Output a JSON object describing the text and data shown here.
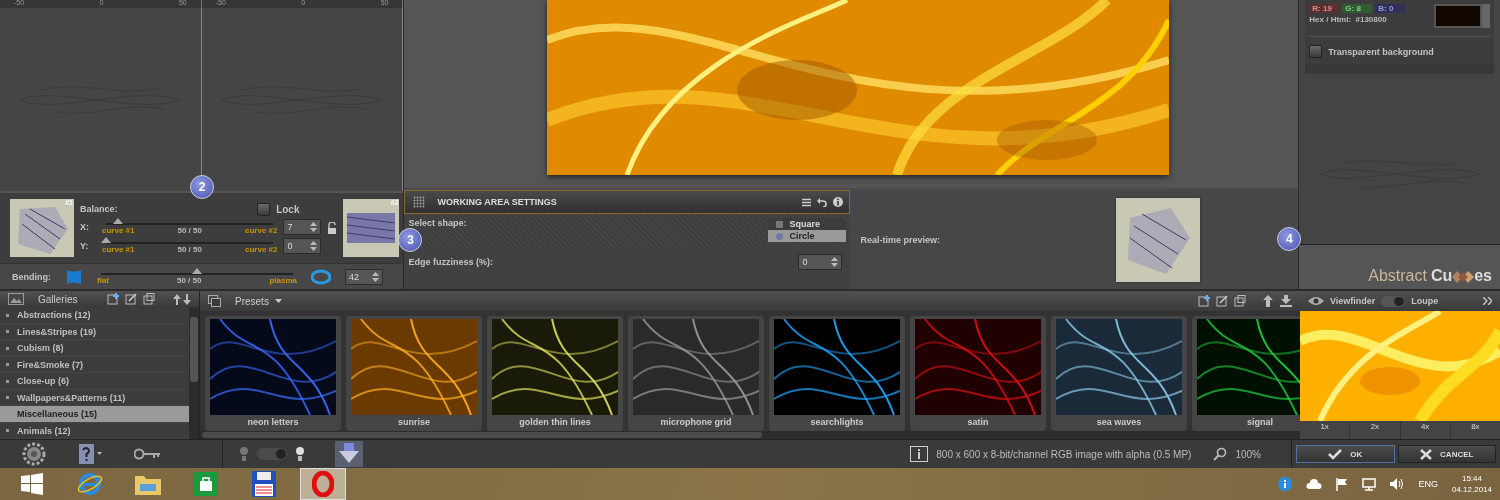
{
  "rulers": [
    {
      "ticks": [
        "-50",
        "0",
        "50"
      ]
    },
    {
      "ticks": [
        "-50",
        "0",
        "50"
      ]
    }
  ],
  "steps": [
    "2",
    "3",
    "4"
  ],
  "balance": {
    "title": "Balance:",
    "lock": {
      "label": "Lock",
      "checked": false
    },
    "thumb1_label": "#1",
    "thumb2_label": "#2",
    "axes": [
      {
        "label": "X:",
        "level": 0.07,
        "left": "curve #1",
        "mid": "50 / 50",
        "right": "curve #2",
        "value": "7"
      },
      {
        "label": "Y:",
        "level": 0,
        "left": "curve #1",
        "mid": "50 / 50",
        "right": "curve #2",
        "value": "0"
      }
    ]
  },
  "bending": {
    "label": "Bending:",
    "level": 0.5,
    "left": "flat",
    "mid": "50 / 50",
    "right": "plasma",
    "value": "42"
  },
  "working_area": {
    "title": "WORKING AREA SETTINGS",
    "shape_label": "Select shape:",
    "shapes": [
      {
        "label": "Square",
        "selected": false
      },
      {
        "label": "Circle",
        "selected": true
      }
    ],
    "fuzziness_label": "Edge fuzziness (%):",
    "fuzziness": "0",
    "preview_label": "Real-time preview:"
  },
  "color": {
    "r_label": "R:",
    "r": "19",
    "g_label": "G:",
    "g": "8",
    "b_label": "B:",
    "b": "0",
    "hex_label": "Hex / Html:",
    "hex": "#130800"
  },
  "transparent_background": {
    "label": "Transparent background",
    "checked": false
  },
  "logo": {
    "word": "Abstract",
    "start": "Cu",
    "end": "es"
  },
  "galleries": {
    "title": "Galleries",
    "items": [
      {
        "label": "Abstractions (12)",
        "selected": false
      },
      {
        "label": "Lines&Stripes (19)",
        "selected": false
      },
      {
        "label": "Cubism (8)",
        "selected": false
      },
      {
        "label": "Fire&Smoke (7)",
        "selected": false
      },
      {
        "label": "Close-up (6)",
        "selected": false
      },
      {
        "label": "Wallpapers&Patterns (11)",
        "selected": false
      },
      {
        "label": "Miscellaneous (15)",
        "selected": true
      },
      {
        "label": "Animals (12)",
        "selected": false
      }
    ]
  },
  "presets": {
    "title": "Presets",
    "items": [
      {
        "label": "neon letters"
      },
      {
        "label": "sunrise"
      },
      {
        "label": "golden thin lines"
      },
      {
        "label": "microphone grid"
      },
      {
        "label": "searchlights"
      },
      {
        "label": "satin"
      },
      {
        "label": "sea waves"
      },
      {
        "label": "signal"
      }
    ]
  },
  "viewfinder": {
    "title": "Viewfinder",
    "alt": "Loupe",
    "loupe_on": true,
    "light_on": true,
    "zooms": [
      "1x",
      "2x",
      "4x",
      "8x"
    ]
  },
  "status": {
    "info": "800 x 600 x 8-bit/channel RGB image with alpha  (0.5 MP)",
    "zoom": "100%"
  },
  "buttons": [
    {
      "label": "OK",
      "kind": "ok"
    },
    {
      "label": "CANCEL",
      "kind": "cancel"
    }
  ],
  "taskbar": {
    "apps": [
      {
        "selected": false
      },
      {
        "selected": false
      },
      {
        "selected": false
      },
      {
        "selected": false
      },
      {
        "selected": false
      },
      {
        "selected": true
      }
    ],
    "lang": "ENG",
    "time": "15:44",
    "date": "04.12.2014"
  }
}
